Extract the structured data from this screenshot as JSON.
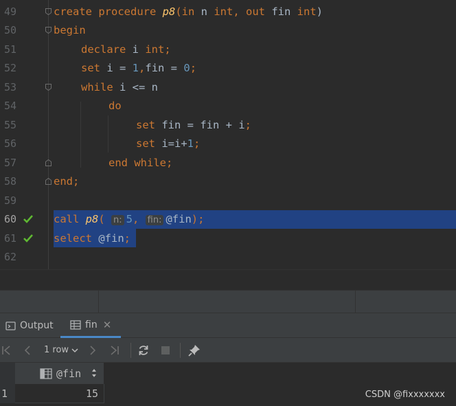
{
  "editor": {
    "lines": [
      {
        "num": "49"
      },
      {
        "num": "50"
      },
      {
        "num": "51"
      },
      {
        "num": "52"
      },
      {
        "num": "53"
      },
      {
        "num": "54"
      },
      {
        "num": "55"
      },
      {
        "num": "56"
      },
      {
        "num": "57"
      },
      {
        "num": "58"
      },
      {
        "num": "59"
      },
      {
        "num": "60"
      },
      {
        "num": "61"
      },
      {
        "num": "62"
      }
    ],
    "code": {
      "l49": {
        "kw1": "create procedure ",
        "name": "p8",
        "p1": "(",
        "kw2": "in",
        "v1": " n ",
        "kw3": "int",
        "p2": ", ",
        "kw4": "out",
        "v2": " fin ",
        "kw5": "int",
        "p3": ")"
      },
      "l50": {
        "kw1": "begin"
      },
      "l51": {
        "kw1": "declare",
        "v1": " i ",
        "kw2": "int",
        "p1": ";"
      },
      "l52": {
        "kw1": "set",
        "v1": " i = ",
        "n1": "1",
        "p1": ",",
        "v2": "fin = ",
        "n2": "0",
        "p2": ";"
      },
      "l53": {
        "kw1": "while",
        "v1": " i <= n"
      },
      "l54": {
        "kw1": "do"
      },
      "l55": {
        "kw1": "set",
        "v1": " fin = fin + i",
        "p1": ";"
      },
      "l56": {
        "kw1": "set",
        "v1": " i=i+",
        "n1": "1",
        "p1": ";"
      },
      "l57": {
        "kw1": "end while",
        "p1": ";"
      },
      "l58": {
        "kw1": "end",
        "p1": ";"
      },
      "l60": {
        "kw1": "call ",
        "name": "p8",
        "p1": "( ",
        "hint1": "n:",
        "n1": "5",
        "p2": ", ",
        "hint2": "fin:",
        "v1": "@fin",
        "p3": ");"
      },
      "l61": {
        "kw1": "select",
        "v1": " @fin",
        "p1": ";"
      }
    }
  },
  "tabs": [
    {
      "label": "Output",
      "icon": "console-icon"
    },
    {
      "label": "fin",
      "icon": "table-icon",
      "close": "✕"
    }
  ],
  "toolbar": {
    "rows_label": "1 row"
  },
  "grid": {
    "columns": [
      "@fin"
    ],
    "rows": [
      {
        "rownum": "1",
        "values": [
          "15"
        ]
      }
    ]
  },
  "watermark": "CSDN @fixxxxxxx",
  "colors": {
    "keyword": "#cc7832",
    "function": "#ffc66d",
    "number": "#6897bb",
    "selection": "#214283",
    "check": "#5fb832"
  }
}
